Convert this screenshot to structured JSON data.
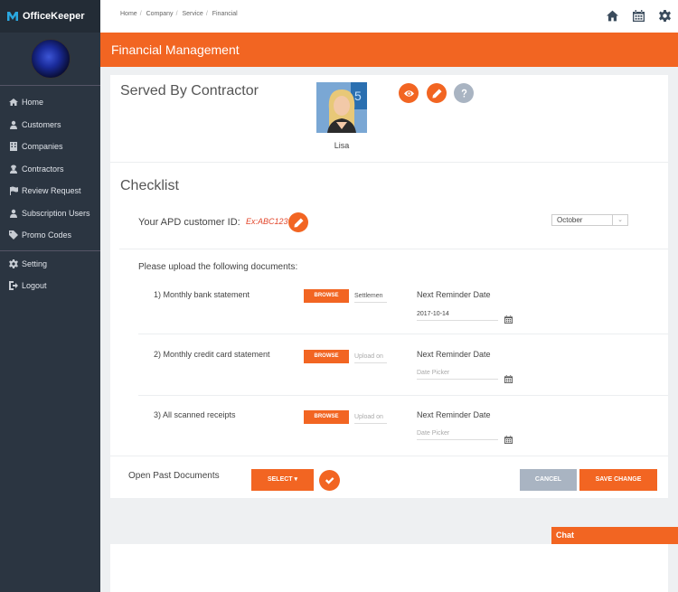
{
  "app": {
    "name": "OfficeKeeper"
  },
  "sidebar": {
    "items": [
      {
        "label": "Home",
        "icon": "home-icon"
      },
      {
        "label": "Customers",
        "icon": "user-icon"
      },
      {
        "label": "Companies",
        "icon": "building-icon"
      },
      {
        "label": "Contractors",
        "icon": "contractor-icon"
      },
      {
        "label": "Review Request",
        "icon": "flag-icon"
      },
      {
        "label": "Subscription Users",
        "icon": "user-icon"
      },
      {
        "label": "Promo Codes",
        "icon": "tag-icon"
      }
    ],
    "secondary": [
      {
        "label": "Setting",
        "icon": "gear-icon"
      },
      {
        "label": "Logout",
        "icon": "logout-icon"
      }
    ]
  },
  "breadcrumb": [
    "Home",
    "Company",
    "Service",
    "Financial"
  ],
  "header": {
    "title": "Financial Management"
  },
  "served": {
    "title": "Served By Contractor",
    "name": "Lisa"
  },
  "checklist": {
    "title": "Checklist",
    "apd_label": "Your APD customer ID:",
    "apd_example": "Ex:ABC123",
    "month": "October",
    "upload_title": "Please upload the following documents:",
    "reminder_label": "Next Reminder Date",
    "browse_label": "BROWSE",
    "documents": [
      {
        "label": "1) Monthly bank statement",
        "file": "Settlemen",
        "date": "2017-10-14"
      },
      {
        "label": "2) Monthly credit card statement",
        "file": "Upload on",
        "date": "Date Picker"
      },
      {
        "label": "3) All scanned receipts",
        "file": "Upload on",
        "date": "Date Picker"
      }
    ]
  },
  "footer": {
    "past_docs_label": "Open Past Documents",
    "select_label": "SELECT",
    "cancel_label": "CANCEL",
    "save_label": "SAVE CHANGE"
  },
  "chat": {
    "label": "Chat"
  },
  "colors": {
    "accent": "#f26522",
    "sidebar": "#2b3541",
    "muted_button": "#a9b4c2"
  }
}
